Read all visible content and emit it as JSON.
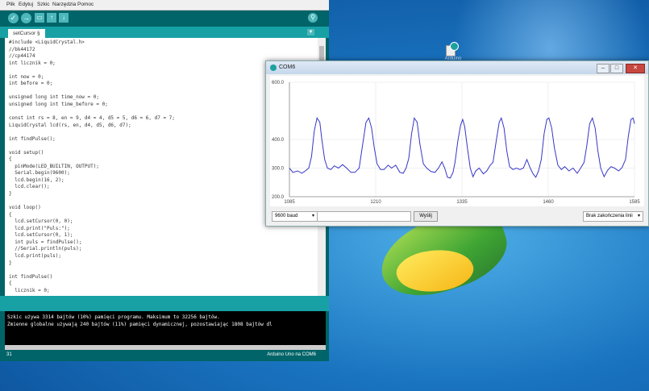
{
  "ide": {
    "menu": [
      "Plik",
      "Edytuj",
      "Szkic",
      "Narzędzia",
      "Pomoc"
    ],
    "toolbar": {
      "verify": "✓",
      "upload": "→",
      "new": "▭",
      "open": "↑",
      "save": "↓",
      "serial": "⚲"
    },
    "tab_label": "setCursor §",
    "tab_menu": "▼",
    "code_lines": [
      "#include <LiquidCrystal.h>",
      "//bk44172",
      "//cp44174",
      "int licznik = 0;",
      "",
      "int now = 0;",
      "int before = 0;",
      "",
      "unsigned long int time_now = 0;",
      "unsigned long int time_before = 0;",
      "",
      "const int rs = 8, en = 9, d4 = 4, d5 = 5, d6 = 6, d7 = 7;",
      "LiquidCrystal lcd(rs, en, d4, d5, d6, d7);",
      "",
      "int findPulse();",
      "",
      "void setup()",
      "{",
      "  pinMode(LED_BUILTIN, OUTPUT);",
      "  Serial.begin(9600);",
      "  lcd.begin(16, 2);",
      "  lcd.clear();",
      "}",
      "",
      "void loop()",
      "{",
      "  lcd.setCursor(0, 0);",
      "  lcd.print(\"Puls:\");",
      "  lcd.setCursor(0, 1);",
      "  int puls = findPulse();",
      "  //Serial.println(puls);",
      "  lcd.print(puls);",
      "}",
      "",
      "int findPulse()",
      "{",
      "  licznik = 0;"
    ],
    "console": [
      "Szkic używa 3314 bajtów (10%) pamięci programu. Maksimum to 32256 bajtów.",
      "Zmienne globalne używają 240 bajtów (11%) pamięci dynamicznej, pozostawiając 1808 bajtów dl"
    ],
    "line_number": "31",
    "board": "Arduino Uno na COM6"
  },
  "desktop_icon_label": "Arduino",
  "plotter": {
    "title": "COM6",
    "win_min": "–",
    "win_max": "□",
    "win_close": "✕",
    "baud": "9600 baud",
    "send_label": "Wyślij",
    "line_ending": "Brak zakończenia linii",
    "caret": "▾"
  },
  "chart_data": {
    "type": "line",
    "x_start": 1085,
    "x_end": 1585,
    "ylim": [
      200,
      600
    ],
    "y_ticks": [
      "600.0",
      "400.0",
      "300.0",
      "200.0"
    ],
    "y_tick_values": [
      600,
      400,
      300,
      200
    ],
    "x_ticks": [
      "1085",
      "1210",
      "1335",
      "1460",
      "1585"
    ],
    "x_tick_values": [
      1085,
      1210,
      1335,
      1460,
      1585
    ],
    "grid": true,
    "color": "#3535c8",
    "points": [
      [
        1085,
        300
      ],
      [
        1090,
        285
      ],
      [
        1097,
        290
      ],
      [
        1103,
        282
      ],
      [
        1108,
        290
      ],
      [
        1113,
        300
      ],
      [
        1117,
        340
      ],
      [
        1121,
        430
      ],
      [
        1125,
        475
      ],
      [
        1129,
        460
      ],
      [
        1132,
        400
      ],
      [
        1136,
        330
      ],
      [
        1140,
        300
      ],
      [
        1145,
        295
      ],
      [
        1150,
        308
      ],
      [
        1156,
        300
      ],
      [
        1162,
        312
      ],
      [
        1168,
        300
      ],
      [
        1174,
        285
      ],
      [
        1180,
        285
      ],
      [
        1186,
        300
      ],
      [
        1191,
        380
      ],
      [
        1196,
        460
      ],
      [
        1200,
        475
      ],
      [
        1204,
        440
      ],
      [
        1208,
        370
      ],
      [
        1212,
        315
      ],
      [
        1217,
        295
      ],
      [
        1222,
        295
      ],
      [
        1228,
        310
      ],
      [
        1233,
        300
      ],
      [
        1239,
        310
      ],
      [
        1245,
        285
      ],
      [
        1250,
        282
      ],
      [
        1254,
        300
      ],
      [
        1258,
        335
      ],
      [
        1262,
        420
      ],
      [
        1266,
        475
      ],
      [
        1270,
        460
      ],
      [
        1274,
        385
      ],
      [
        1279,
        315
      ],
      [
        1284,
        300
      ],
      [
        1290,
        288
      ],
      [
        1296,
        285
      ],
      [
        1301,
        300
      ],
      [
        1306,
        322
      ],
      [
        1310,
        300
      ],
      [
        1314,
        268
      ],
      [
        1318,
        265
      ],
      [
        1322,
        285
      ],
      [
        1325,
        320
      ],
      [
        1329,
        395
      ],
      [
        1333,
        450
      ],
      [
        1336,
        470
      ],
      [
        1339,
        445
      ],
      [
        1343,
        370
      ],
      [
        1347,
        300
      ],
      [
        1351,
        270
      ],
      [
        1355,
        290
      ],
      [
        1360,
        300
      ],
      [
        1366,
        280
      ],
      [
        1371,
        290
      ],
      [
        1376,
        310
      ],
      [
        1380,
        320
      ],
      [
        1385,
        400
      ],
      [
        1389,
        460
      ],
      [
        1392,
        475
      ],
      [
        1396,
        440
      ],
      [
        1400,
        360
      ],
      [
        1404,
        305
      ],
      [
        1409,
        295
      ],
      [
        1414,
        300
      ],
      [
        1419,
        295
      ],
      [
        1424,
        300
      ],
      [
        1429,
        330
      ],
      [
        1434,
        300
      ],
      [
        1438,
        280
      ],
      [
        1442,
        268
      ],
      [
        1446,
        290
      ],
      [
        1450,
        330
      ],
      [
        1454,
        420
      ],
      [
        1458,
        470
      ],
      [
        1461,
        475
      ],
      [
        1465,
        440
      ],
      [
        1469,
        370
      ],
      [
        1474,
        310
      ],
      [
        1479,
        295
      ],
      [
        1484,
        305
      ],
      [
        1490,
        290
      ],
      [
        1496,
        300
      ],
      [
        1502,
        282
      ],
      [
        1507,
        300
      ],
      [
        1512,
        320
      ],
      [
        1516,
        380
      ],
      [
        1520,
        455
      ],
      [
        1524,
        475
      ],
      [
        1528,
        440
      ],
      [
        1532,
        360
      ],
      [
        1536,
        300
      ],
      [
        1541,
        270
      ],
      [
        1546,
        292
      ],
      [
        1551,
        305
      ],
      [
        1556,
        300
      ],
      [
        1562,
        290
      ],
      [
        1567,
        302
      ],
      [
        1572,
        330
      ],
      [
        1576,
        410
      ],
      [
        1580,
        470
      ],
      [
        1583,
        475
      ],
      [
        1585,
        455
      ]
    ]
  }
}
